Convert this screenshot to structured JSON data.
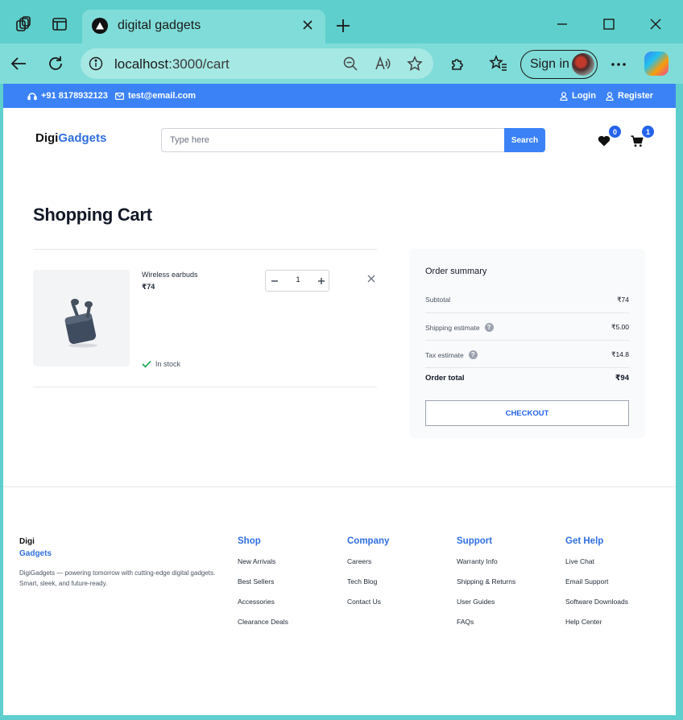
{
  "browser": {
    "tab_title": "digital gadgets",
    "url_host": "localhost",
    "url_rest": ":3000/cart",
    "signin_label": "Sign in"
  },
  "topbar": {
    "phone": "+91 8178932123",
    "email": "test@email.com",
    "login": "Login",
    "register": "Register"
  },
  "header": {
    "logo_part1": "Digi",
    "logo_part2": "Gadgets",
    "search_placeholder": "Type here",
    "search_button": "Search",
    "wishlist_count": "0",
    "cart_count": "1"
  },
  "cart": {
    "title": "Shopping Cart",
    "items": [
      {
        "name": "Wireless earbuds",
        "price": "₹74",
        "quantity": "1",
        "stock": "In stock"
      }
    ]
  },
  "summary": {
    "title": "Order summary",
    "rows": [
      {
        "label": "Subtotal",
        "value": "₹74"
      },
      {
        "label": "Shipping estimate",
        "value": "₹5.00"
      },
      {
        "label": "Tax estimate",
        "value": "₹14.8"
      }
    ],
    "total_label": "Order total",
    "total_value": "₹94",
    "checkout_label": "CHECKOUT"
  },
  "footer": {
    "logo_part1": "Digi",
    "logo_part2": "Gadgets",
    "description": "DigiGadgets — powering tomorrow with cutting-edge digital gadgets. Smart, sleek, and future-ready.",
    "columns": [
      {
        "heading": "Shop",
        "links": [
          "New Arrivals",
          "Best Sellers",
          "Accessories",
          "Clearance Deals"
        ]
      },
      {
        "heading": "Company",
        "links": [
          "Careers",
          "Tech Blog",
          "Contact Us"
        ]
      },
      {
        "heading": "Support",
        "links": [
          "Warranty Info",
          "Shipping & Returns",
          "User Guides",
          "FAQs"
        ]
      },
      {
        "heading": "Get Help",
        "links": [
          "Live Chat",
          "Email Support",
          "Software Downloads",
          "Help Center"
        ]
      }
    ]
  },
  "colors": {
    "brand_blue": "#3b82f6",
    "accent_blue": "#2f6fe0",
    "browser_frame": "#5ecfcc",
    "success_green": "#16a34a"
  }
}
